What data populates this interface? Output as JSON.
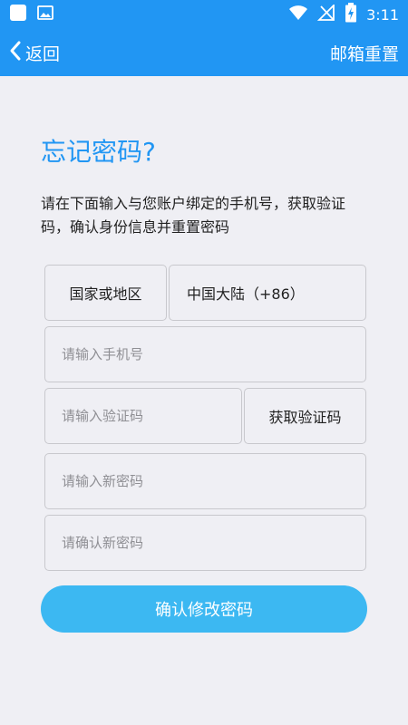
{
  "status_bar": {
    "time": "3:11"
  },
  "nav": {
    "back_label": "返回",
    "action_label": "邮箱重置"
  },
  "form": {
    "title": "忘记密码?",
    "description": "请在下面输入与您账户绑定的手机号，获取验证码，确认身份信息并重置密码",
    "country_label": "国家或地区",
    "country_value": "中国大陆（+86）",
    "phone_placeholder": "请输入手机号",
    "code_placeholder": "请输入验证码",
    "get_code_label": "获取验证码",
    "new_password_placeholder": "请输入新密码",
    "confirm_password_placeholder": "请确认新密码",
    "submit_label": "确认修改密码"
  },
  "colors": {
    "primary": "#2196f3",
    "button": "#3cb8f2",
    "background": "#efeff4"
  }
}
